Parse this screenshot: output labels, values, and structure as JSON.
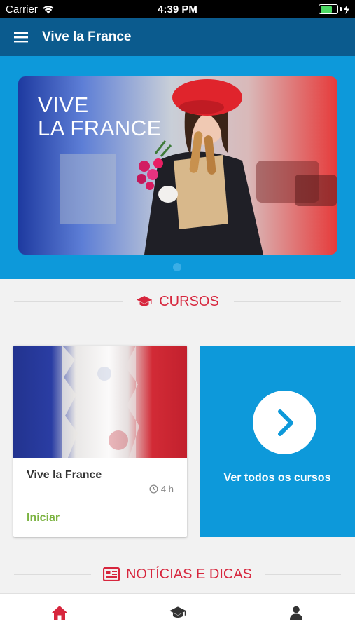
{
  "status_bar": {
    "carrier": "Carrier",
    "time": "4:39 PM"
  },
  "app_bar": {
    "title": "Vive la France",
    "menu_icon": "hamburger-menu-icon"
  },
  "hero": {
    "banner_line1": "VIVE",
    "banner_line2": "LA FRANCE",
    "carousel_index": 1,
    "carousel_count": 1
  },
  "courses_section": {
    "title": "CURSOS",
    "icon": "graduation-cap-icon"
  },
  "course_card": {
    "title": "Vive la France",
    "duration": "4 h",
    "action": "Iniciar"
  },
  "all_courses": {
    "label": "Ver todos os cursos",
    "icon": "chevron-right-icon"
  },
  "news_section": {
    "title": "NOTÍCIAS E DICAS",
    "icon": "newspaper-icon"
  },
  "bottom_nav": {
    "items": [
      {
        "name": "home",
        "icon": "home-icon",
        "active": true
      },
      {
        "name": "courses",
        "icon": "graduation-cap-icon",
        "active": false
      },
      {
        "name": "profile",
        "icon": "person-icon",
        "active": false
      }
    ]
  },
  "colors": {
    "primary_dark": "#0b5b8e",
    "primary": "#0d99da",
    "accent_red": "#d7263d",
    "accent_green": "#7cb342",
    "background": "#f2f2f2"
  }
}
